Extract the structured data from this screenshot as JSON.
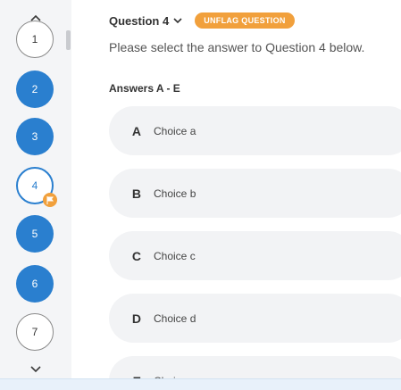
{
  "nav": {
    "questions": [
      {
        "number": "1",
        "state": "unanswered"
      },
      {
        "number": "2",
        "state": "answered"
      },
      {
        "number": "3",
        "state": "answered"
      },
      {
        "number": "4",
        "state": "current",
        "flagged": true
      },
      {
        "number": "5",
        "state": "answered"
      },
      {
        "number": "6",
        "state": "answered"
      },
      {
        "number": "7",
        "state": "unanswered"
      }
    ],
    "icons": {
      "up": "chevron-up-icon",
      "down": "chevron-down-icon",
      "flag": "flag-icon"
    }
  },
  "question": {
    "title": "Question 4",
    "unflag_label": "UNFLAG QUESTION",
    "instruction": "Please select the answer to Question 4 below.",
    "answers_label": "Answers A - E",
    "choices": [
      {
        "letter": "A",
        "text": "Choice a"
      },
      {
        "letter": "B",
        "text": "Choice b"
      },
      {
        "letter": "C",
        "text": "Choice c"
      },
      {
        "letter": "D",
        "text": "Choice d"
      },
      {
        "letter": "E",
        "text": "Choice e"
      }
    ]
  },
  "colors": {
    "answered": "#2a7fcf",
    "flag": "#f1a03c",
    "choice_bg": "#f2f3f5",
    "rail_bg": "#f4f5f7"
  }
}
